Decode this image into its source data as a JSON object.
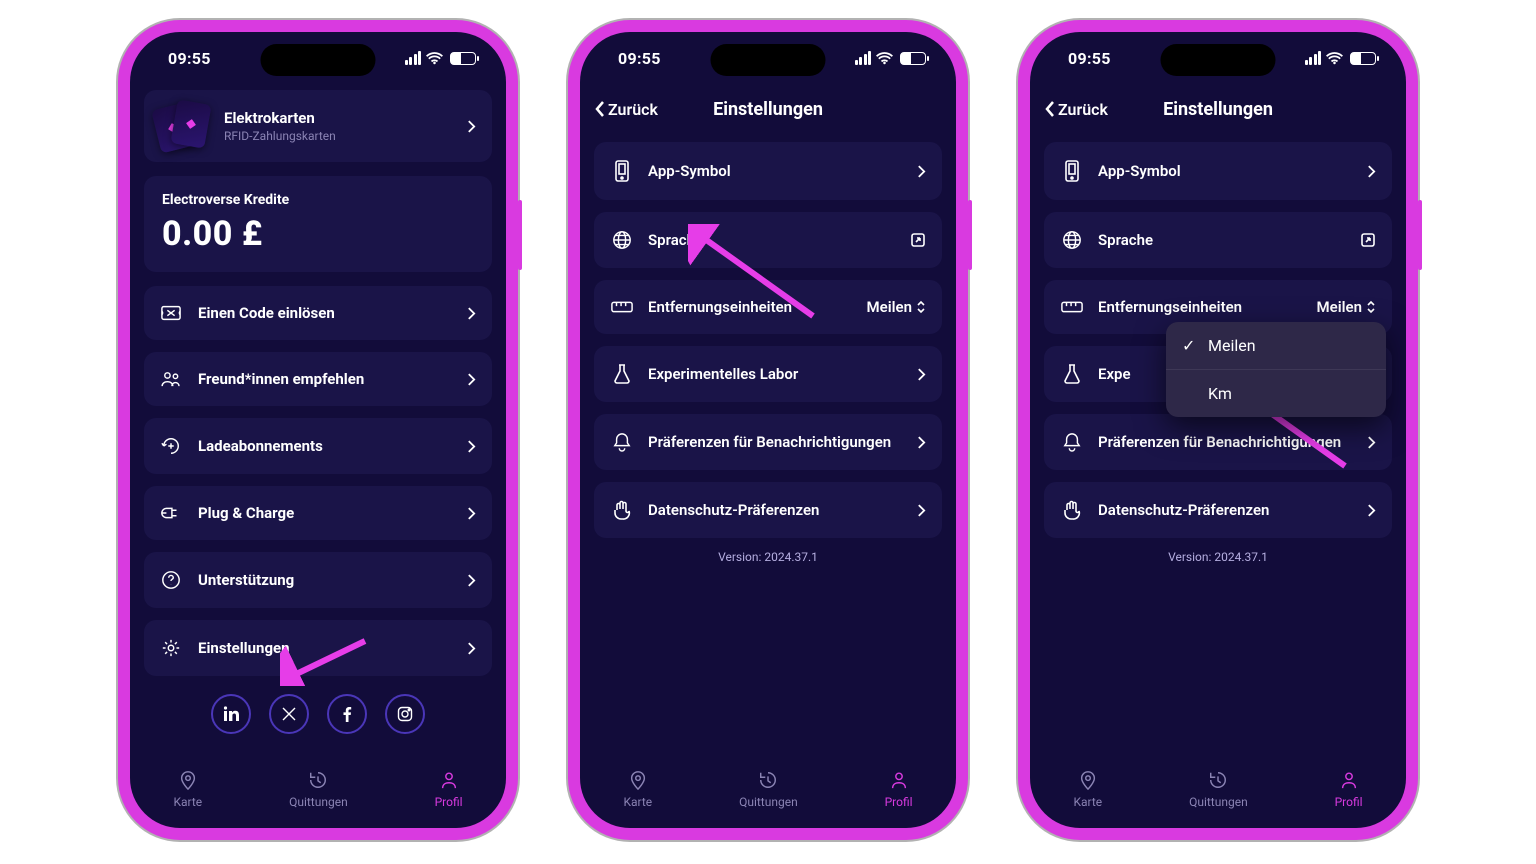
{
  "status": {
    "time": "09:55"
  },
  "tabs": {
    "map": "Karte",
    "receipts": "Quittungen",
    "profile": "Profil"
  },
  "screen1": {
    "elektrokarten": {
      "title": "Elektrokarten",
      "subtitle": "RFID-Zahlungskarten"
    },
    "credits": {
      "label": "Electroverse Kredite",
      "amount": "0.00 £"
    },
    "items": {
      "redeem": "Einen Code einlösen",
      "refer": "Freund*innen empfehlen",
      "subs": "Ladeabonnements",
      "plug": "Plug & Charge",
      "support": "Unterstützung",
      "settings": "Einstellungen"
    }
  },
  "screen2": {
    "back": "Zurück",
    "title": "Einstellungen",
    "items": {
      "appicon": "App-Symbol",
      "language": "Sprache",
      "distance": "Entfernungseinheiten",
      "distance_value": "Meilen",
      "lab": "Experimentelles Labor",
      "notif": "Präferenzen für Benachrichtigungen",
      "privacy": "Datenschutz-Präferenzen"
    },
    "version": "Version: 2024.37.1"
  },
  "screen3": {
    "back": "Zurück",
    "title": "Einstellungen",
    "items": {
      "appicon": "App-Symbol",
      "language": "Sprache",
      "distance": "Entfernungseinheiten",
      "distance_value": "Meilen",
      "lab_partial": "Expe",
      "notif": "Präferenzen für Benachrichtigungen",
      "privacy": "Datenschutz-Präferenzen"
    },
    "dropdown": {
      "option1": "Meilen",
      "option2": "Km"
    },
    "version": "Version: 2024.37.1"
  }
}
